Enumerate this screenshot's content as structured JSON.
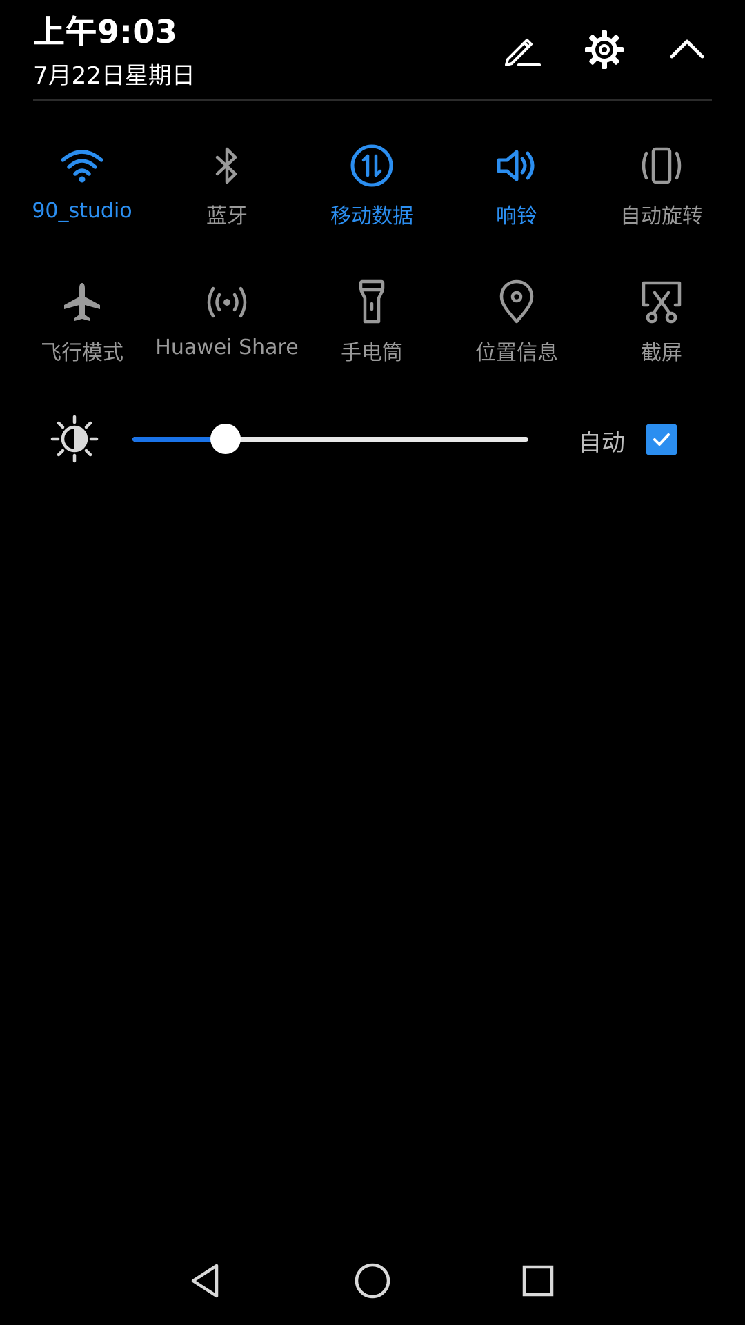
{
  "status": {
    "time": "上午9:03",
    "date": "7月22日星期日"
  },
  "header_actions": [
    {
      "icon": "edit-icon"
    },
    {
      "icon": "gear-icon"
    },
    {
      "icon": "chevron-up-icon"
    }
  ],
  "toggles": [
    {
      "id": "wifi",
      "label": "90_studio",
      "icon": "wifi-icon",
      "state": "on"
    },
    {
      "id": "bluetooth",
      "label": "蓝牙",
      "icon": "bluetooth-icon",
      "state": "off"
    },
    {
      "id": "mobile-data",
      "label": "移动数据",
      "icon": "mobile-data-icon",
      "state": "on"
    },
    {
      "id": "ring",
      "label": "响铃",
      "icon": "speaker-icon",
      "state": "on"
    },
    {
      "id": "auto-rotate",
      "label": "自动旋转",
      "icon": "rotate-icon",
      "state": "off"
    },
    {
      "id": "airplane",
      "label": "飞行模式",
      "icon": "airplane-icon",
      "state": "off"
    },
    {
      "id": "huawei-share",
      "label": "Huawei Share",
      "icon": "share-signal-icon",
      "state": "off"
    },
    {
      "id": "flashlight",
      "label": "手电筒",
      "icon": "flashlight-icon",
      "state": "off"
    },
    {
      "id": "location",
      "label": "位置信息",
      "icon": "location-pin-icon",
      "state": "off"
    },
    {
      "id": "screenshot",
      "label": "截屏",
      "icon": "screenshot-icon",
      "state": "off"
    }
  ],
  "brightness": {
    "icon": "brightness-icon",
    "level": 0.235,
    "auto_label": "自动",
    "auto_checked": true
  },
  "nav": [
    {
      "icon": "back-icon"
    },
    {
      "icon": "home-icon"
    },
    {
      "icon": "recent-apps-icon"
    }
  ],
  "colors": {
    "active": "#2b8ef0",
    "inactive": "#9a9a9a",
    "background": "#000000"
  }
}
